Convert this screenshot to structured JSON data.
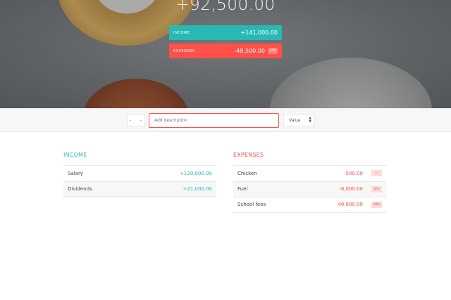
{
  "hero": {
    "balance": "+92,500.00",
    "income": {
      "label": "INCOME",
      "value": "+141,000.00"
    },
    "expenses": {
      "label": "EXPENSES",
      "value": "-48,500.00",
      "percentage": "34%"
    }
  },
  "add_bar": {
    "type_value": "-",
    "description_placeholder": "Add description",
    "value_placeholder": "Value"
  },
  "income": {
    "title": "INCOME",
    "items": [
      {
        "description": "Salary",
        "value": "+120,000.00"
      },
      {
        "description": "Dividends",
        "value": "+21,000.00"
      }
    ]
  },
  "expenses": {
    "title": "EXPENSES",
    "items": [
      {
        "description": "Chicken",
        "value": "-500.00",
        "percentage": "---"
      },
      {
        "description": "Fuel",
        "value": "-8,000.00",
        "percentage": "6%"
      },
      {
        "description": "School fees",
        "value": "40,000.00",
        "percentage": "28%"
      }
    ]
  },
  "colors": {
    "income_accent": "#28b9b5",
    "expense_accent": "#ff5049"
  }
}
